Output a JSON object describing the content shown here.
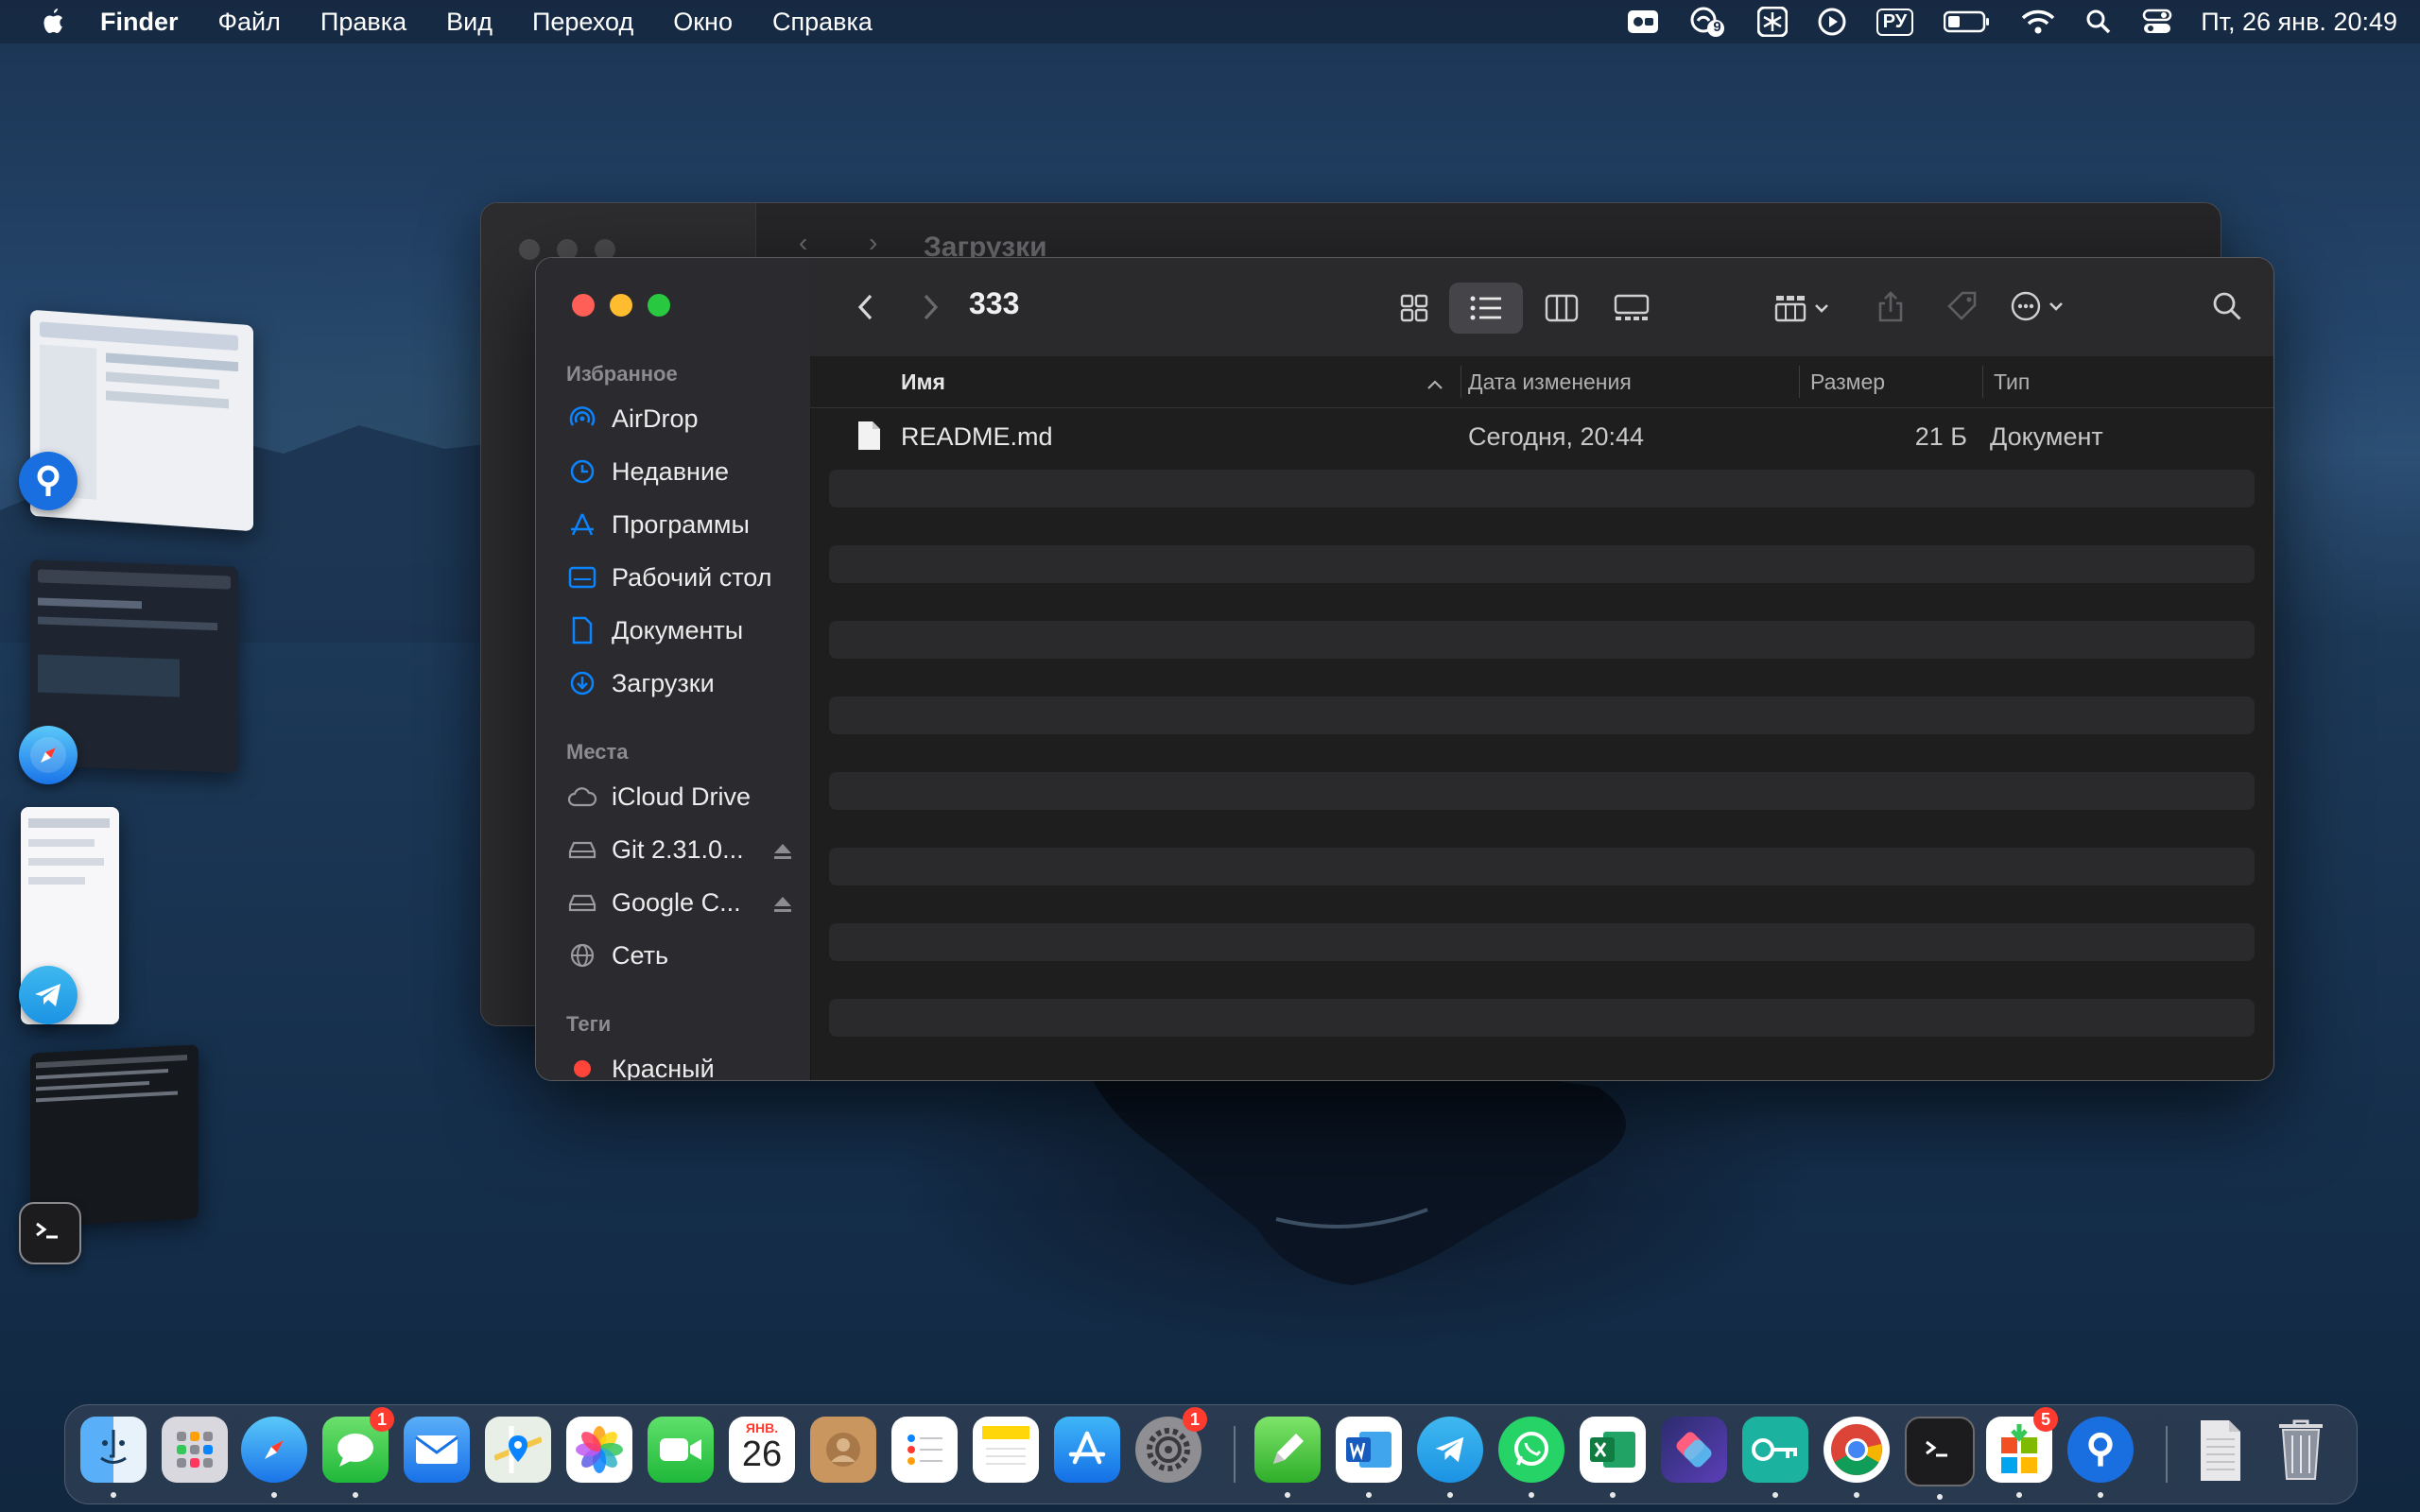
{
  "menubar": {
    "app_name": "Finder",
    "items": [
      "Файл",
      "Правка",
      "Вид",
      "Переход",
      "Окно",
      "Справка"
    ],
    "status_badge": "9",
    "input_language": "РУ",
    "clock": "Пт, 26 янв.  20:49"
  },
  "back_window": {
    "title": "Загрузки"
  },
  "finder": {
    "title": "333",
    "sidebar": {
      "favorites_header": "Избранное",
      "favorites": [
        "AirDrop",
        "Недавние",
        "Программы",
        "Рабочий стол",
        "Документы",
        "Загрузки"
      ],
      "locations_header": "Места",
      "locations": [
        "iCloud Drive",
        "Git 2.31.0...",
        "Google C...",
        "Сеть"
      ],
      "tags_header": "Теги",
      "tags": [
        "Красный"
      ]
    },
    "columns": {
      "name": "Имя",
      "date": "Дата изменения",
      "size": "Размер",
      "kind": "Тип"
    },
    "files": [
      {
        "name": "README.md",
        "date": "Сегодня, 20:44",
        "size": "21 Б",
        "kind": "Документ"
      }
    ]
  },
  "dock": {
    "calendar_month": "ЯНВ.",
    "calendar_day": "26",
    "messages_badge": "1",
    "settings_badge": "1",
    "office_badge": "5"
  },
  "colors": {
    "accent": "#0a84ff",
    "close": "#ff5f57",
    "minimize": "#febc2e",
    "zoom": "#28c840",
    "tag_red": "#ff453a"
  }
}
